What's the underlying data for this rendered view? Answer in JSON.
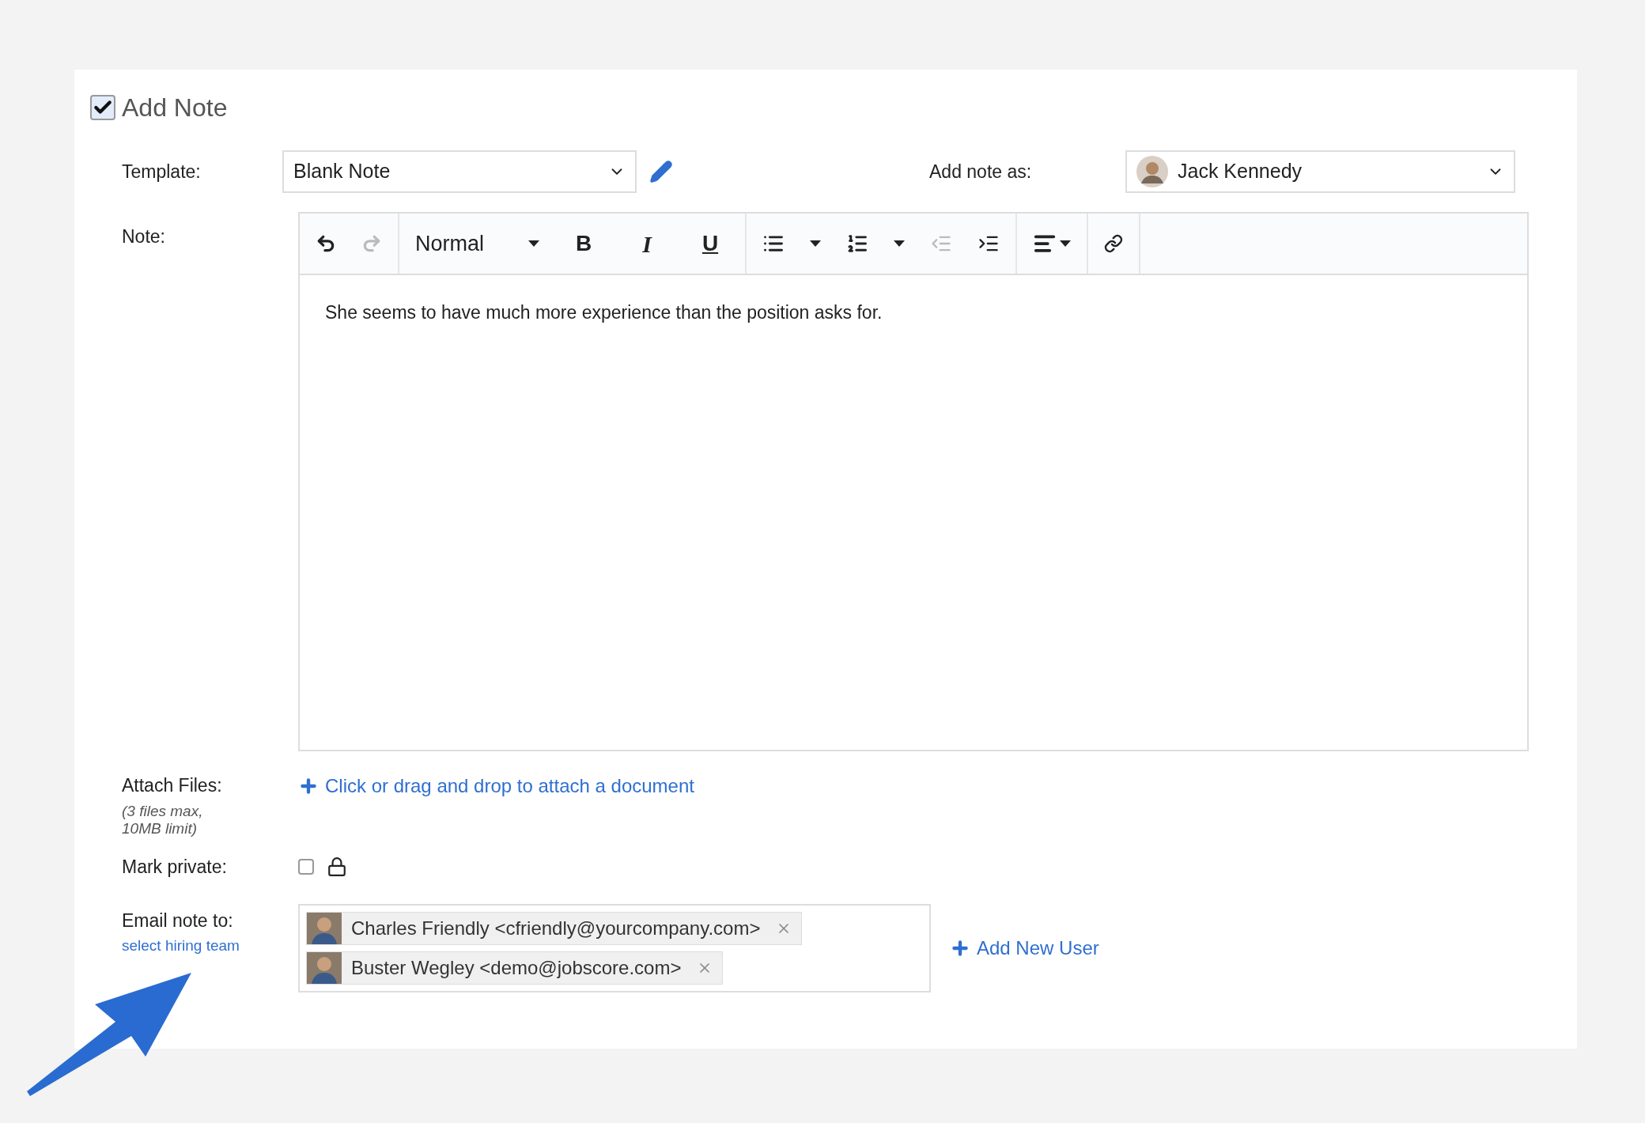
{
  "header": {
    "title": "Add Note",
    "checked": true
  },
  "template": {
    "label": "Template:",
    "value": "Blank Note"
  },
  "author": {
    "label": "Add note as:",
    "value": "Jack Kennedy"
  },
  "note": {
    "label": "Note:",
    "toolbar": [
      [
        {
          "kind": "undo",
          "disabled": false
        },
        {
          "kind": "redo",
          "disabled": true
        }
      ],
      [
        {
          "kind": "style",
          "label": "Normal",
          "disabled": false
        },
        {
          "kind": "bold",
          "label": "B",
          "disabled": false
        },
        {
          "kind": "italic",
          "label": "I",
          "disabled": false
        },
        {
          "kind": "underline",
          "label": "U",
          "disabled": false
        }
      ],
      [
        {
          "kind": "bullets",
          "disabled": false
        },
        {
          "kind": "caret",
          "disabled": false
        },
        {
          "kind": "numbers",
          "disabled": false
        },
        {
          "kind": "caret",
          "disabled": false
        },
        {
          "kind": "outdent",
          "disabled": true
        },
        {
          "kind": "indent",
          "disabled": false
        }
      ],
      [
        {
          "kind": "align",
          "disabled": false
        }
      ],
      [
        {
          "kind": "link",
          "disabled": false
        }
      ]
    ],
    "text": "She seems to have much more experience than the position asks for."
  },
  "attach": {
    "label": "Attach Files:",
    "hint": "(3 files max, 10MB limit)",
    "link": "Click or drag and drop to attach a document"
  },
  "private": {
    "label": "Mark private:",
    "checked": false
  },
  "email": {
    "label": "Email note to:",
    "link": "select hiring team",
    "recipients": [
      "Charles Friendly <cfriendly@yourcompany.com>",
      "Buster Wegley <demo@jobscore.com>"
    ],
    "add": "Add New User"
  }
}
